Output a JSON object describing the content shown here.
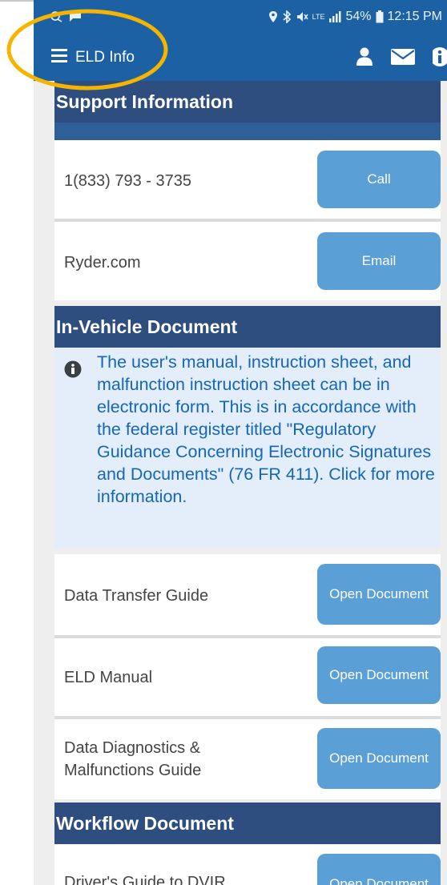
{
  "statusbar": {
    "time": "12:15 PM",
    "battery": "54%",
    "network": "LTE"
  },
  "appbar": {
    "title": "ELD Info",
    "icons": [
      "menu-icon",
      "user-icon",
      "mail-icon",
      "info-icon"
    ]
  },
  "support": {
    "heading": "Support Information",
    "phone": "1(833) 793 - 3735",
    "call_label": "Call",
    "website": "Ryder.com",
    "email_label": "Email"
  },
  "in_vehicle": {
    "heading": "In-Vehicle Document",
    "info_text": "The user's manual, instruction sheet, and malfunction instruction sheet can be in electronic form. This is in accordance with the federal register titled \"Regulatory Guidance Concerning Electronic Signatures and Documents\" (76 FR 411). Click for more information.",
    "documents": [
      {
        "name": "Data Transfer Guide",
        "button": "Open Document"
      },
      {
        "name": "ELD Manual",
        "button": "Open Document"
      },
      {
        "name": "Data Diagnostics & Malfunctions Guide",
        "button": "Open Document"
      }
    ]
  },
  "workflow": {
    "heading": "Workflow Document",
    "documents": [
      {
        "name": "Driver's Guide to DVIR",
        "button": "Open Document"
      }
    ]
  },
  "colors": {
    "primary": "#1b61a4",
    "section_header": "#2e4e7f",
    "button": "#5a9fd5",
    "info_text": "#1467b8",
    "info_bg": "#e4eefa",
    "highlight_ring": "#f4b400"
  }
}
